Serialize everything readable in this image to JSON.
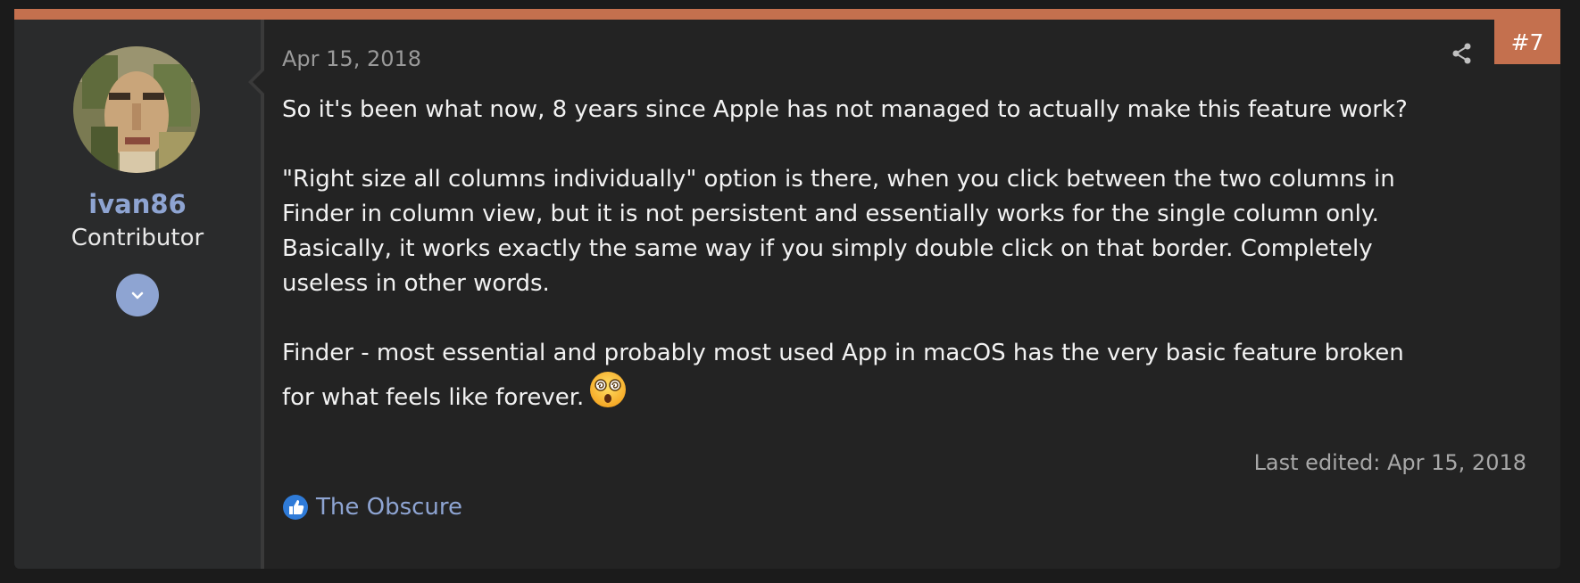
{
  "post": {
    "number": "#7",
    "date": "Apr 15, 2018",
    "last_edited": "Last edited: Apr 15, 2018",
    "accent_color": "#c4704e"
  },
  "user": {
    "name": "ivan86",
    "title": "Contributor",
    "name_color": "#8ea4d2"
  },
  "body": {
    "p1": "So it's been what now, 8 years since Apple has not managed to actually make this feature work?",
    "p2_l1": "\"Right size all columns individually\" option is there, when you click between the two columns in",
    "p2_l2": "Finder in column view, but it is not persistent and essentially works for the single column only.",
    "p2_l3": "Basically, it works exactly the same way if you simply double click on that border. Completely",
    "p2_l4": "useless in other words.",
    "p3_l1": "Finder - most essential and probably most used App in macOS has the very basic feature broken",
    "p3_l2": "for what feels like forever.",
    "emoji": "dizzy-face-emoji"
  },
  "reactions": {
    "icon": "like-icon",
    "users": "The Obscure"
  },
  "icons": {
    "share": "share-icon",
    "expand": "chevron-down-icon"
  }
}
